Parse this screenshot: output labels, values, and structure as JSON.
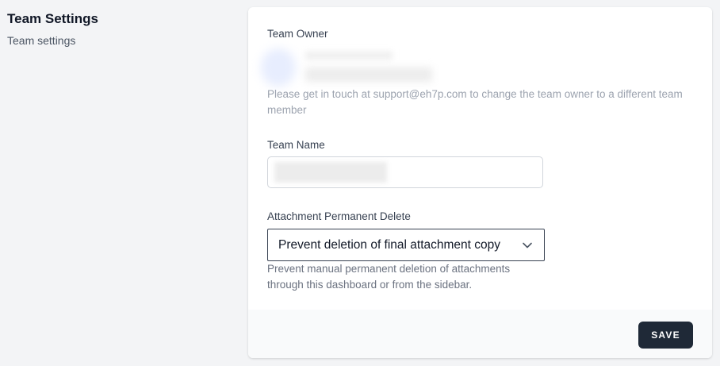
{
  "header": {
    "title": "Team Settings",
    "subtitle": "Team settings"
  },
  "owner": {
    "label": "Team Owner",
    "help": "Please get in touch at support@eh7p.com to change the team owner to a different team member"
  },
  "team_name": {
    "label": "Team Name",
    "value": ""
  },
  "attachment_delete": {
    "label": "Attachment Permanent Delete",
    "selected": "Prevent deletion of final attachment copy",
    "help": "Prevent manual permanent deletion of attachments through this dashboard or from the sidebar."
  },
  "footer": {
    "save_label": "SAVE"
  },
  "icons": {
    "select": "chevron-down-icon"
  },
  "colors": {
    "button_bg": "#1f2937",
    "page_bg": "#f3f4f6"
  }
}
